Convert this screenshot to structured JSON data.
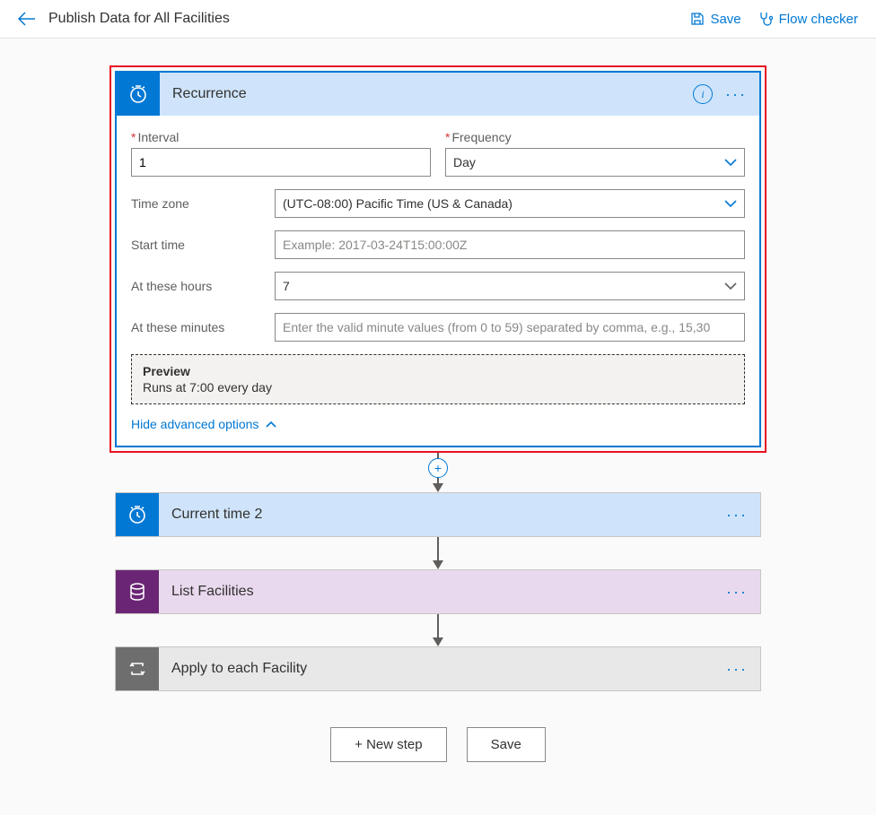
{
  "topbar": {
    "title": "Publish Data for All Facilities",
    "save": "Save",
    "flowchecker": "Flow checker"
  },
  "recurrence": {
    "title": "Recurrence",
    "interval_label": "Interval",
    "interval_value": "1",
    "frequency_label": "Frequency",
    "frequency_value": "Day",
    "timezone_label": "Time zone",
    "timezone_value": "(UTC-08:00) Pacific Time (US & Canada)",
    "starttime_label": "Start time",
    "starttime_placeholder": "Example: 2017-03-24T15:00:00Z",
    "hours_label": "At these hours",
    "hours_value": "7",
    "minutes_label": "At these minutes",
    "minutes_placeholder": "Enter the valid minute values (from 0 to 59) separated by comma, e.g., 15,30",
    "preview_title": "Preview",
    "preview_text": "Runs at 7:00 every day",
    "hide_adv": "Hide advanced options"
  },
  "steps": {
    "currenttime": "Current time 2",
    "listfacilities": "List Facilities",
    "applytoeach": "Apply to each Facility"
  },
  "buttons": {
    "newstep": "+ New step",
    "save": "Save"
  }
}
